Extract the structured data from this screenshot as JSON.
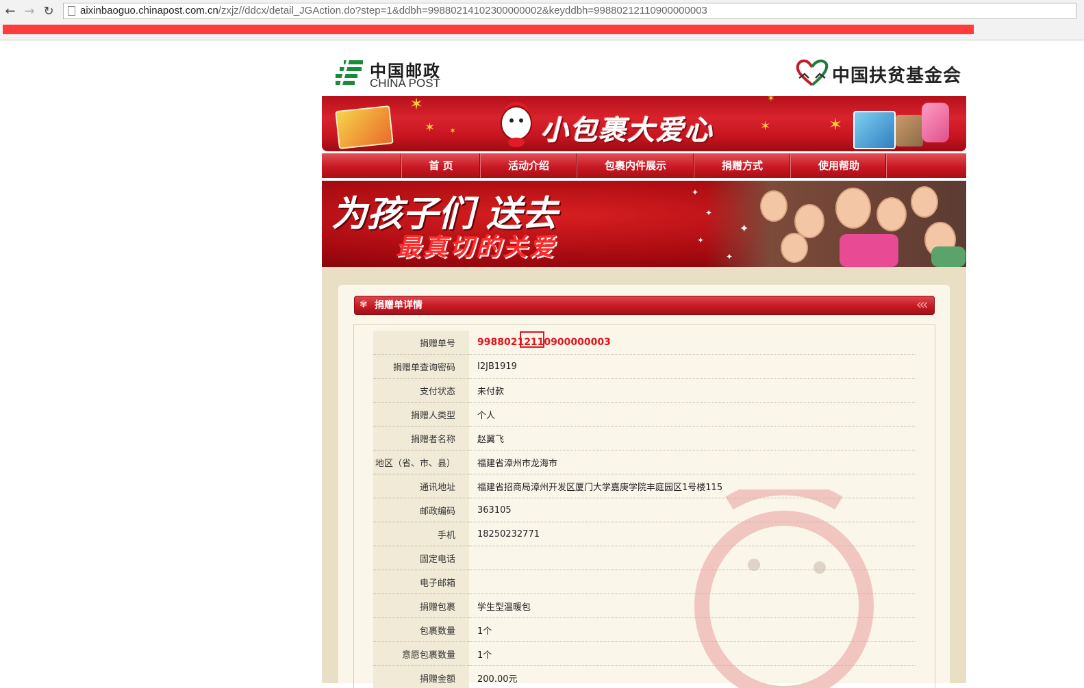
{
  "browser": {
    "url_host": "aixinbaoguo.chinapost.com.cn",
    "url_path": "/zxjz//ddcx/detail_JGAction.do?step=1&ddbh=99880214102300000002&keyddbh=99880212110900000003"
  },
  "header": {
    "post_logo_cn": "中国邮政",
    "post_logo_en": "CHINA POST",
    "fund_logo": "中国扶贫基金会",
    "banner_title": "小包裹大爱心"
  },
  "nav": {
    "items": [
      {
        "label": "首 页"
      },
      {
        "label": "活动介绍"
      },
      {
        "label": "包裹内件展示"
      },
      {
        "label": "捐赠方式"
      },
      {
        "label": "使用帮助"
      }
    ]
  },
  "hero": {
    "line1": "为孩子们 送去",
    "line2": "最真切的关爱"
  },
  "panel": {
    "title": "捐赠单详情"
  },
  "details": [
    {
      "label": "捐赠单号",
      "value": "99880212110900000003"
    },
    {
      "label": "捐赠单查询密码",
      "value": "I2JB1919"
    },
    {
      "label": "支付状态",
      "value": "未付款"
    },
    {
      "label": "捐赠人类型",
      "value": "个人"
    },
    {
      "label": "捐赠者名称",
      "value": "赵翼飞"
    },
    {
      "label": "地区（省、市、县）",
      "value": "福建省漳州市龙海市"
    },
    {
      "label": "通讯地址",
      "value": "福建省招商局漳州开发区厦门大学嘉庚学院丰庭园区1号楼115"
    },
    {
      "label": "邮政编码",
      "value": "363105"
    },
    {
      "label": "手机",
      "value": "18250232771"
    },
    {
      "label": "固定电话",
      "value": ""
    },
    {
      "label": "电子邮箱",
      "value": ""
    },
    {
      "label": "捐赠包裹",
      "value": "学生型温暖包"
    },
    {
      "label": "包裹数量",
      "value": "1个"
    },
    {
      "label": "意愿包裹数量",
      "value": "1个"
    },
    {
      "label": "捐赠金额",
      "value": "200.00元"
    }
  ],
  "colors": {
    "brand_red": "#c51b24",
    "order_no_red": "#e3141b",
    "panel_bg": "#faf6ea",
    "content_bg": "#e8dfc4"
  }
}
